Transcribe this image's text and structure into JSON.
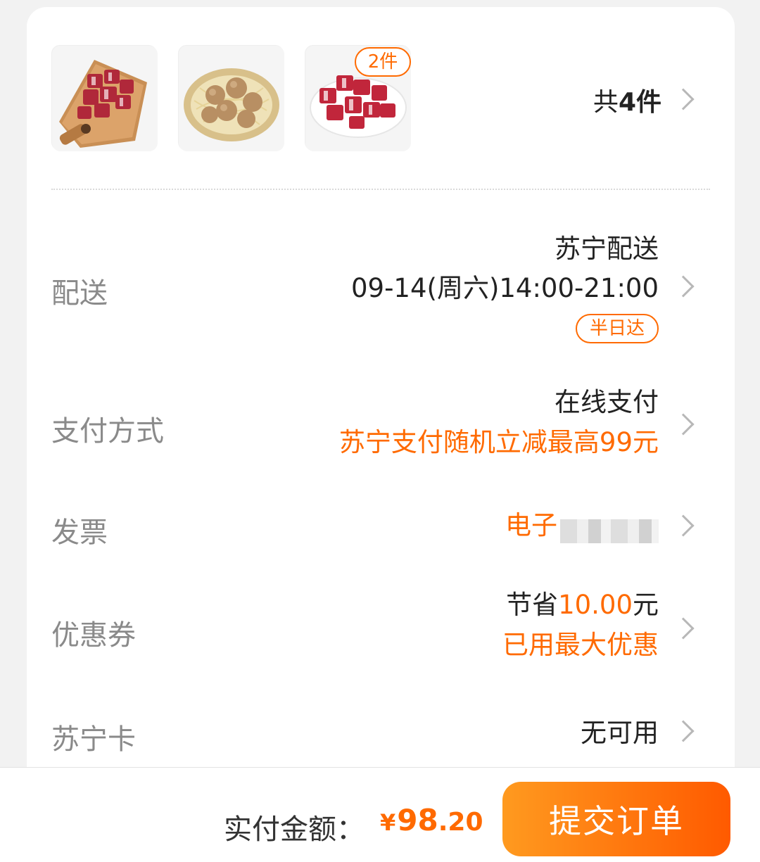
{
  "items": {
    "thumbnails": [
      {
        "icon": "beef-cubes-board-image"
      },
      {
        "icon": "beef-balls-basket-image"
      },
      {
        "icon": "beef-cubes-plate-image",
        "badge": "2件"
      }
    ],
    "total_prefix": "共",
    "total_count": "4件"
  },
  "delivery": {
    "label": "配送",
    "method": "苏宁配送",
    "time": "09-14(周六)14:00-21:00",
    "tag": "半日达"
  },
  "payment": {
    "label": "支付方式",
    "method": "在线支付",
    "promo": "苏宁支付随机立减最高99元"
  },
  "invoice": {
    "label": "发票",
    "value": "电子"
  },
  "coupon": {
    "label": "优惠券",
    "save_prefix": "节省",
    "save_amount": "10.00",
    "save_suffix": "元",
    "status": "已用最大优惠"
  },
  "card": {
    "label": "苏宁卡",
    "value": "无可用"
  },
  "footer": {
    "pay_label": "实付金额：",
    "currency": "¥",
    "amount_int": "98",
    "amount_dec": ".20",
    "submit_label": "提交订单"
  },
  "colors": {
    "accent": "#ff6a00",
    "button_start": "#ff9a1f",
    "button_end": "#ff5a00"
  }
}
